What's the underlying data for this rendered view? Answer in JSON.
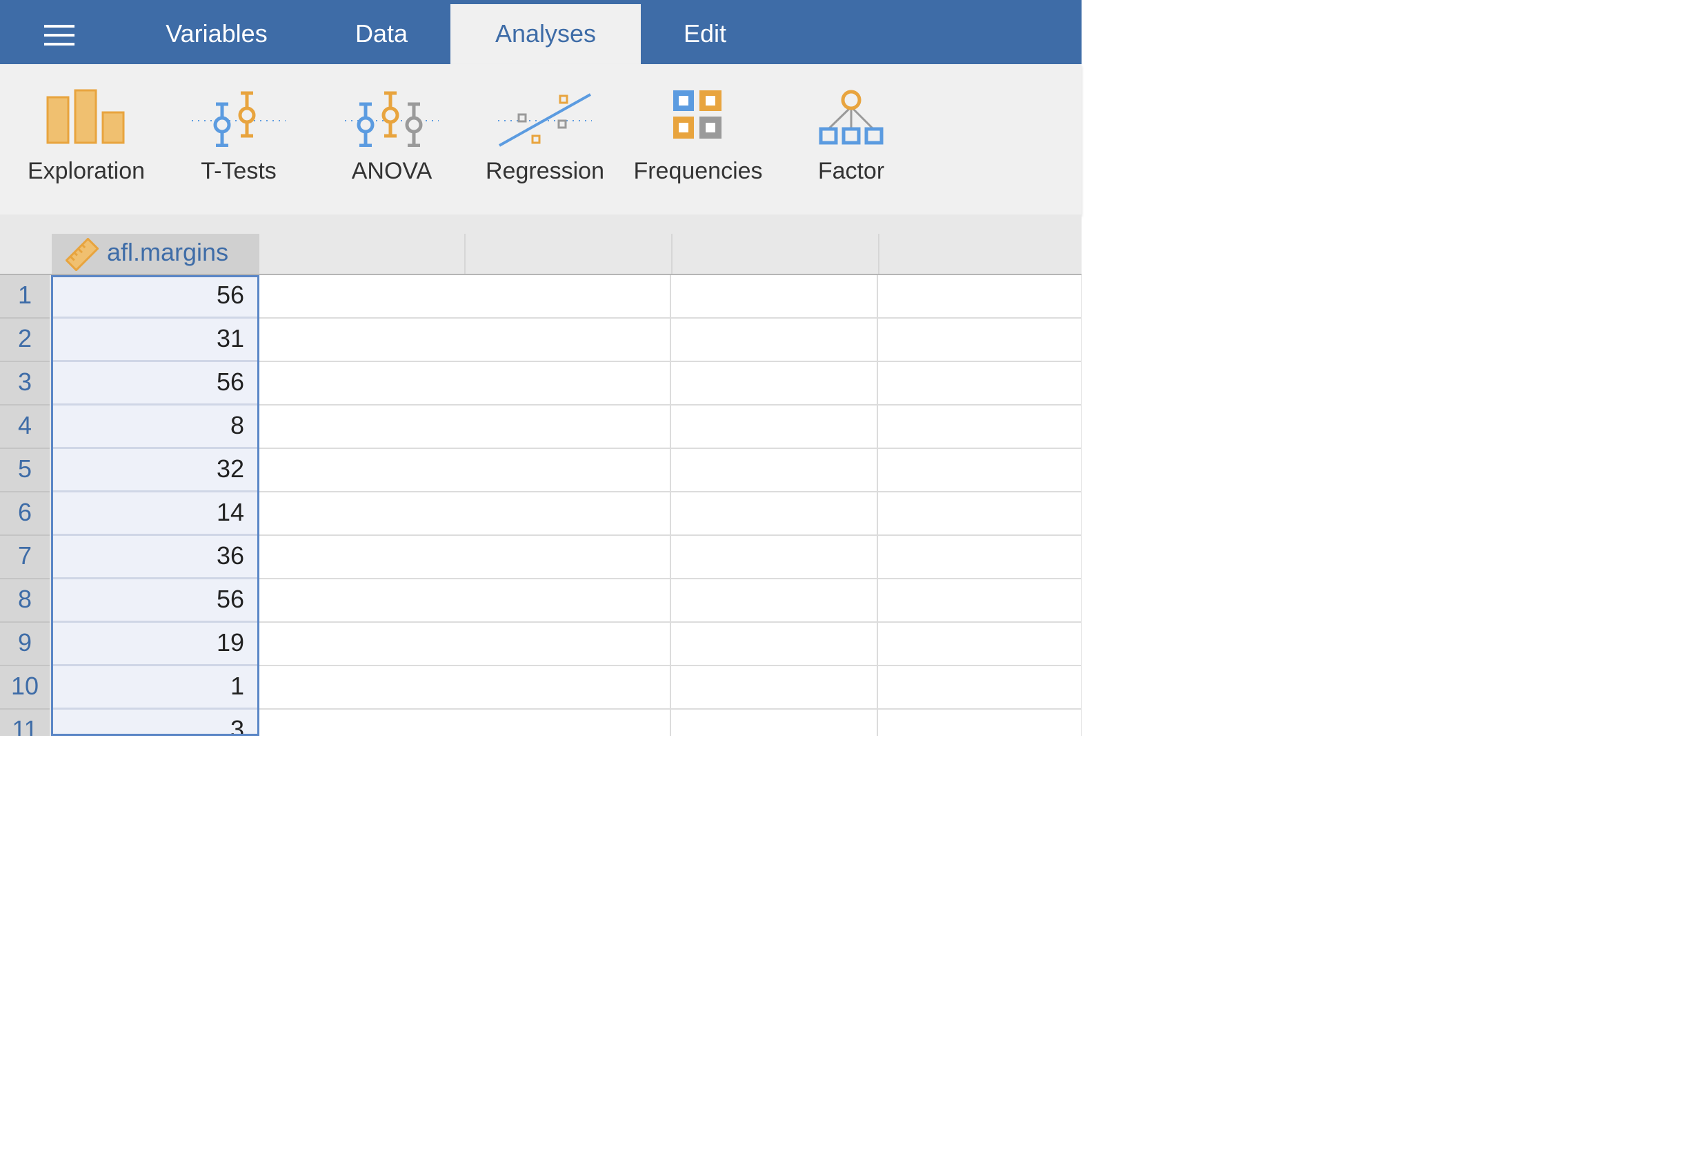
{
  "tabs": [
    {
      "label": "Variables",
      "active": false
    },
    {
      "label": "Data",
      "active": false
    },
    {
      "label": "Analyses",
      "active": true
    },
    {
      "label": "Edit",
      "active": false
    }
  ],
  "ribbon": {
    "exploration": "Exploration",
    "ttests": "T-Tests",
    "anova": "ANOVA",
    "regression": "Regression",
    "frequencies": "Frequencies",
    "factor": "Factor"
  },
  "colors": {
    "brand": "#3e6ca7",
    "orange": "#e8a43e",
    "blue": "#5b9be0",
    "grey": "#9a9a9a"
  },
  "column": {
    "name": "afl.margins",
    "type_icon": "ruler-icon"
  },
  "rows": [
    {
      "n": "1",
      "v": "56"
    },
    {
      "n": "2",
      "v": "31"
    },
    {
      "n": "3",
      "v": "56"
    },
    {
      "n": "4",
      "v": "8"
    },
    {
      "n": "5",
      "v": "32"
    },
    {
      "n": "6",
      "v": "14"
    },
    {
      "n": "7",
      "v": "36"
    },
    {
      "n": "8",
      "v": "56"
    },
    {
      "n": "9",
      "v": "19"
    },
    {
      "n": "10",
      "v": "1"
    },
    {
      "n": "11",
      "v": "3"
    }
  ]
}
